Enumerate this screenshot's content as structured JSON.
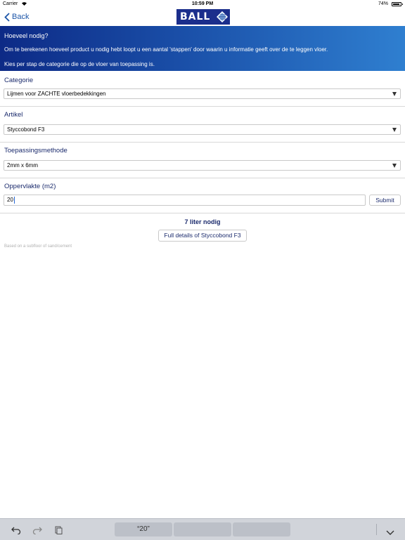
{
  "status": {
    "carrier": "Carrier",
    "time": "10:59 PM",
    "battery": "74%"
  },
  "nav": {
    "back_label": "Back",
    "logo_text": "BALL"
  },
  "hero": {
    "title": "Hoeveel nodig?",
    "description": "Om te berekenen hoeveel product u nodig hebt loopt u een aantal 'stappen' door waarin u informatie geeft over de te leggen vloer.",
    "instruction": "Kies per stap de categorie die op de vloer van toepassing is."
  },
  "form": {
    "categorie": {
      "label": "Categorie",
      "value": "Lijmen voor ZACHTE vloerbedekkingen"
    },
    "artikel": {
      "label": "Artikel",
      "value": "Styccobond F3"
    },
    "methode": {
      "label": "Toepassingsmethode",
      "value": "2mm x 6mm"
    },
    "oppervlakte": {
      "label": "Oppervlakte (m2)",
      "value": "20",
      "submit_label": "Submit"
    }
  },
  "result": {
    "text": "7 liter nodig",
    "details_button": "Full details of Styccobond F3",
    "note": "Based on a subfloor of sand/cement"
  },
  "keyboard": {
    "suggestions": [
      "“20”",
      "",
      ""
    ]
  },
  "colors": {
    "brand_blue": "#1b2e8c",
    "header_gradient_start": "#0d2a86",
    "header_gradient_end": "#2f7fd0",
    "link_blue": "#1c55a8"
  }
}
